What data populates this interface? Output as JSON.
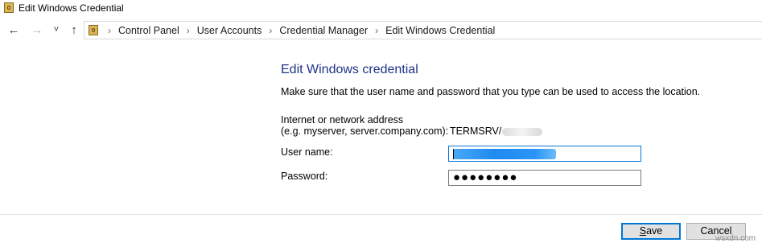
{
  "window": {
    "title": "Edit Windows Credential",
    "icon": "credential-manager-icon"
  },
  "nav": {
    "back_icon": "←",
    "forward_icon": "→",
    "recent_icon": "˅",
    "up_icon": "↑",
    "breadcrumbs": [
      "Control Panel",
      "User Accounts",
      "Credential Manager",
      "Edit Windows Credential"
    ]
  },
  "form": {
    "heading": "Edit Windows credential",
    "description": "Make sure that the user name and password that you type can be used to access the location.",
    "address_label_line1": "Internet or network address",
    "address_label_line2": "(e.g. myserver, server.company.com):",
    "address_value": "TERMSRV/",
    "username_label": "User name:",
    "password_label": "Password:",
    "password_mask": "●●●●●●●●"
  },
  "buttons": {
    "save_prefix": "",
    "save_underlined": "S",
    "save_rest": "ave",
    "cancel": "Cancel"
  },
  "watermark": "wsxdn.com",
  "colors": {
    "heading": "#1e3287",
    "focus_border": "#0a78d7",
    "default_button_border": "#0078d7"
  }
}
